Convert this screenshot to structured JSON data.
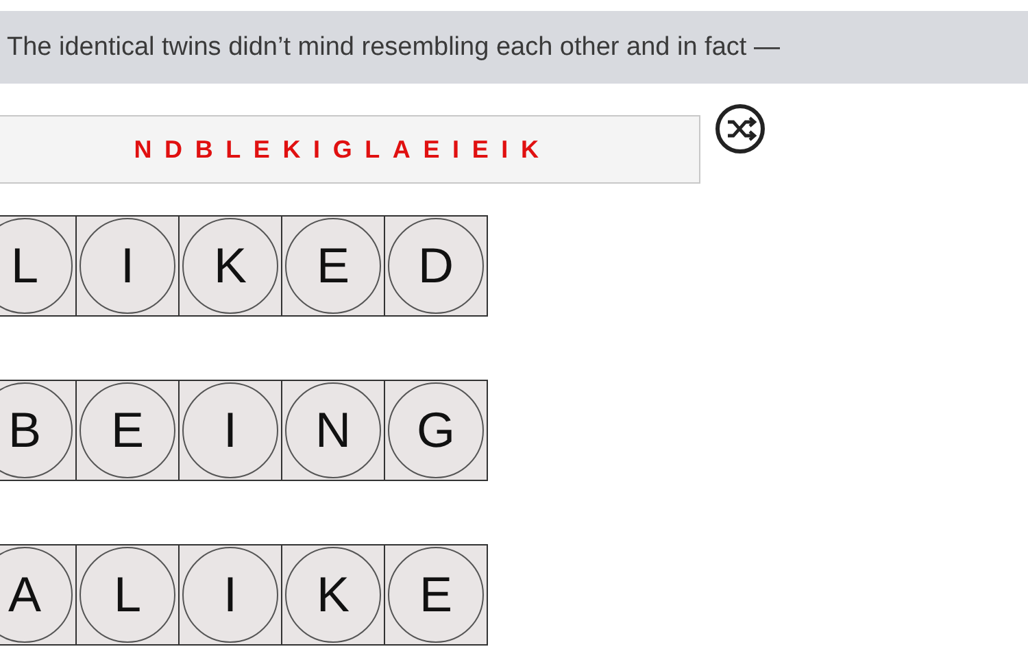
{
  "clue": "The identical twins didn’t mind resembling each other and in fact —",
  "scramble": "NDBLEKIGLAEIEIK",
  "words": [
    {
      "letters": [
        "L",
        "I",
        "K",
        "E",
        "D"
      ]
    },
    {
      "letters": [
        "B",
        "E",
        "I",
        "N",
        "G"
      ]
    },
    {
      "letters": [
        "A",
        "L",
        "I",
        "K",
        "E"
      ]
    }
  ]
}
